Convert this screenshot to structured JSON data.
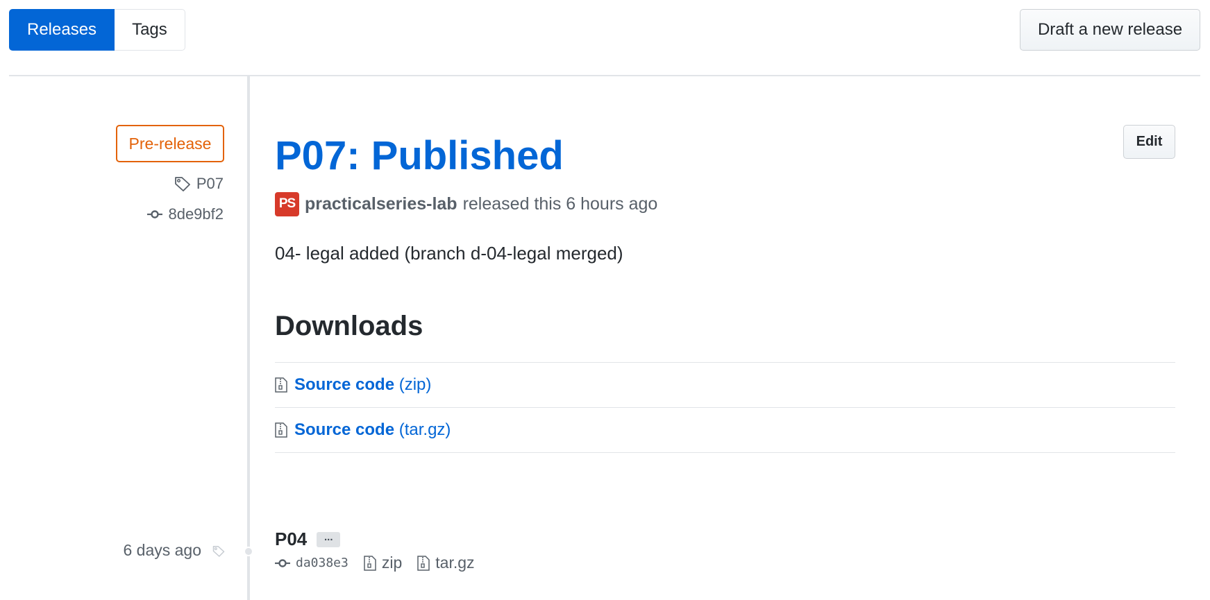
{
  "subnav": {
    "releases_label": "Releases",
    "tags_label": "Tags"
  },
  "draft_button_label": "Draft a new release",
  "latest_release": {
    "badge": "Pre-release",
    "tag": "P07",
    "commit": "8de9bf2",
    "title": "P07: Published",
    "edit_label": "Edit",
    "avatar_text": "PS",
    "author": "practicalseries-lab",
    "released_text": "released this 6 hours ago",
    "body": "04- legal added (branch d-04-legal merged)",
    "downloads_heading": "Downloads",
    "downloads": [
      {
        "label": "Source code",
        "ext": "(zip)"
      },
      {
        "label": "Source code",
        "ext": "(tar.gz)"
      }
    ]
  },
  "older_release": {
    "date": "6 days ago",
    "title": "P04",
    "ellipsis": "...",
    "commit": "da038e3",
    "zip_label": "zip",
    "targz_label": "tar.gz"
  },
  "colors": {
    "accent": "#0366d6",
    "prerelease": "#e36209",
    "muted": "#586069",
    "border": "#e1e4e8",
    "avatar": "#d73a2a"
  },
  "icons": [
    "tag-icon",
    "git-commit-icon",
    "file-zip-icon"
  ]
}
